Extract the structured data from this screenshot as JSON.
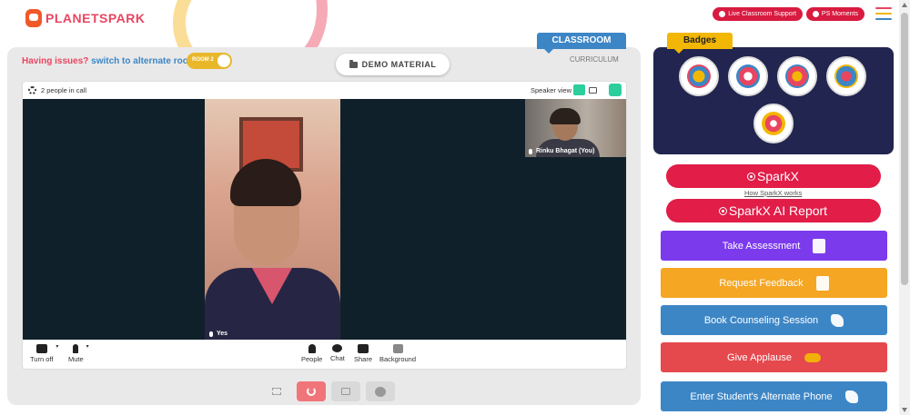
{
  "app": {
    "logo_text": "PLANETSPARK",
    "live_support_label": "Live Classroom Support",
    "ps_moments_label": "PS Moments"
  },
  "classroom": {
    "tab_label": "CLASSROOM",
    "curriculum_label": "CURRICULUM",
    "issues_question": "Having issues?",
    "issues_link": "switch to alternate room",
    "room_toggle_label": "ROOM 2",
    "demo_material_label": "DEMO MATERIAL"
  },
  "call": {
    "people_count": "2 people in call",
    "speaker_view_label": "Speaker view",
    "student_name": "Yes",
    "teacher_name": "Rinku Bhagat (You)",
    "controls": {
      "camera_label": "Turn off",
      "mic_label": "Mute",
      "people_label": "People",
      "chat_label": "Chat",
      "share_label": "Share",
      "background_label": "Background"
    }
  },
  "badges": {
    "tab_label": "Badges",
    "items": [
      "trophy-badge",
      "superhero-badge",
      "star-girl-badge",
      "rocket-badge",
      "robot-badge"
    ]
  },
  "sparkx": {
    "primary_label": "SparkX",
    "how_link": "How SparkX works",
    "report_label": "SparkX AI Report"
  },
  "actions": {
    "assessment": "Take Assessment",
    "feedback": "Request Feedback",
    "counseling": "Book Counseling Session",
    "applause": "Give Applause",
    "alternate_phone": "Enter Student's Alternate Phone"
  },
  "colors": {
    "brand_red": "#e11d48",
    "brand_blue": "#3d86c6",
    "brand_yellow": "#f2b705",
    "badge_panel": "#22254f",
    "assessment": "#7c3aed",
    "feedback": "#f5a623",
    "counseling": "#3d86c6",
    "applause": "#e5484d",
    "alternate_phone": "#3d86c6"
  }
}
